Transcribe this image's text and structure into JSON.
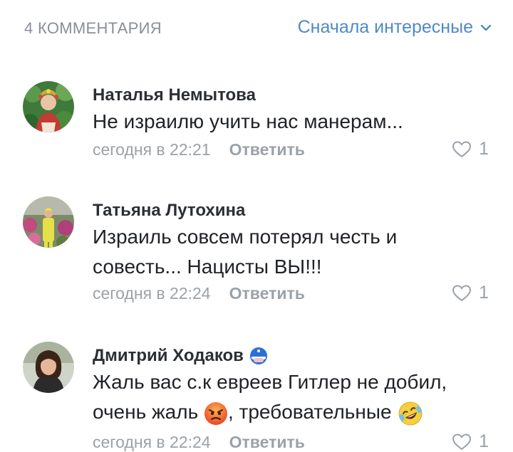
{
  "header": {
    "comments_count": "4 КОММЕНТАРИЯ",
    "sort_label": "Сначала интересные"
  },
  "comments": [
    {
      "author": "Наталья Немытова",
      "text": "Не израилю учить нас манерам...",
      "time": "сегодня в 22:21",
      "reply": "Ответить",
      "likes": "1"
    },
    {
      "author": "Татьяна Лутохина",
      "text": "Израиль совсем потерял честь и совесть... Нацисты ВЫ!!!",
      "time": "сегодня в 22:24",
      "reply": "Ответить",
      "likes": "1"
    },
    {
      "author": "Дмитрий Ходаков",
      "text_part1": "Жаль вас с.к евреев Гитлер не добил, очень жаль",
      "text_part2": ", требовательные",
      "time": "сегодня в 22:24",
      "reply": "Ответить",
      "likes": "1"
    }
  ],
  "colors": {
    "accent": "#4f8ac4",
    "muted": "#9ba1a8",
    "text": "#1f2226"
  },
  "icons": [
    "chevron-down-icon",
    "heart-icon",
    "angry-face-icon",
    "rofl-face-icon",
    "author-badge-icon"
  ]
}
